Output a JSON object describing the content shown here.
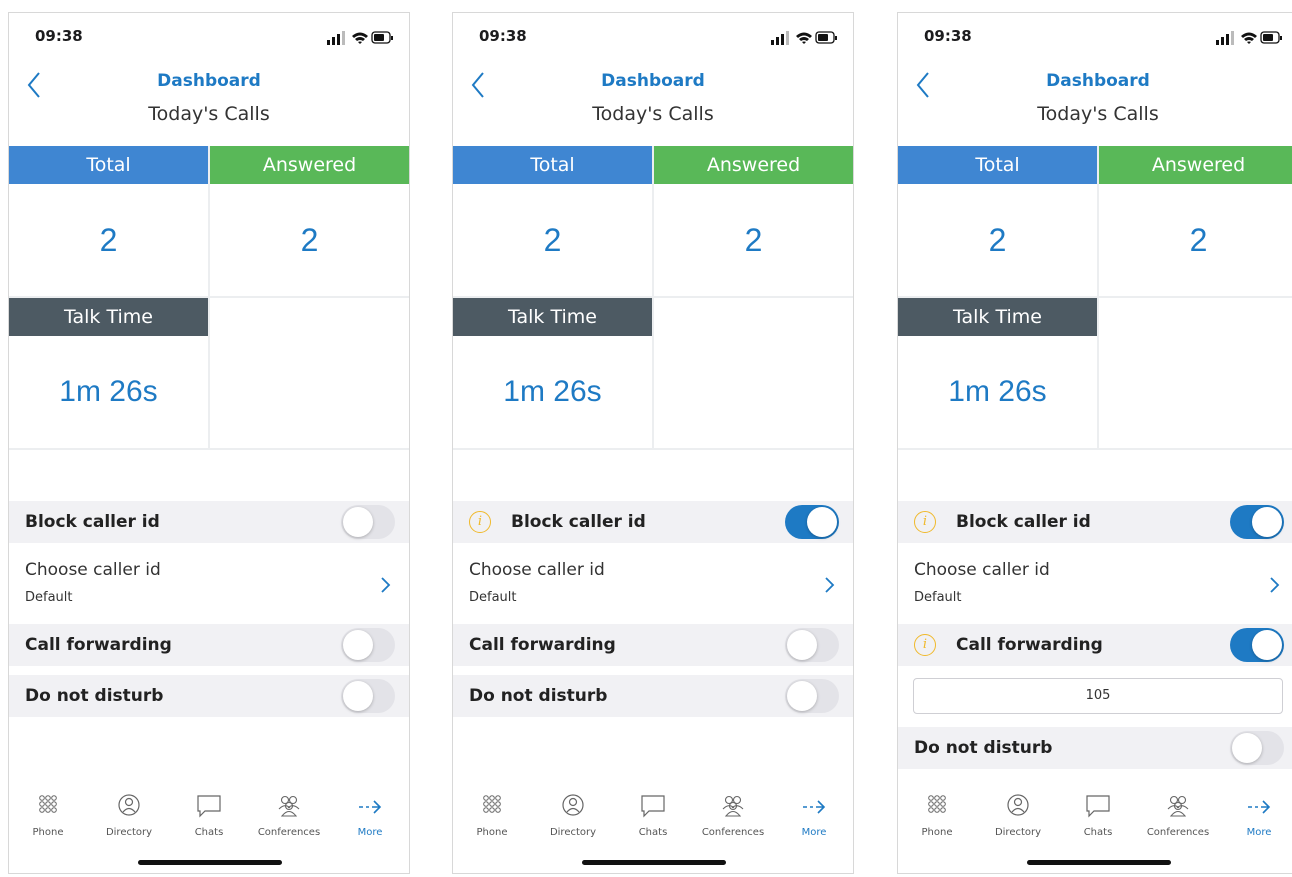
{
  "screens": [
    {
      "status_time": "09:38",
      "nav_title": "Dashboard",
      "nav_subtitle": "Today's Calls",
      "tiles": {
        "total_label": "Total",
        "total_value": "2",
        "answered_label": "Answered",
        "answered_value": "2",
        "talk_label": "Talk Time",
        "talk_value": "1m 26s"
      },
      "block_caller_id": {
        "label": "Block caller id",
        "on": false
      },
      "choose_caller_id": {
        "label": "Choose caller id",
        "value": "Default"
      },
      "call_forwarding": {
        "label": "Call forwarding",
        "on": false
      },
      "do_not_disturb": {
        "label": "Do not disturb",
        "on": false
      }
    },
    {
      "status_time": "09:38",
      "nav_title": "Dashboard",
      "nav_subtitle": "Today's Calls",
      "tiles": {
        "total_label": "Total",
        "total_value": "2",
        "answered_label": "Answered",
        "answered_value": "2",
        "talk_label": "Talk Time",
        "talk_value": "1m 26s"
      },
      "block_caller_id": {
        "label": "Block caller id",
        "on": true
      },
      "choose_caller_id": {
        "label": "Choose caller id",
        "value": "Default"
      },
      "call_forwarding": {
        "label": "Call forwarding",
        "on": false
      },
      "do_not_disturb": {
        "label": "Do not disturb",
        "on": false
      }
    },
    {
      "status_time": "09:38",
      "nav_title": "Dashboard",
      "nav_subtitle": "Today's Calls",
      "tiles": {
        "total_label": "Total",
        "total_value": "2",
        "answered_label": "Answered",
        "answered_value": "2",
        "talk_label": "Talk Time",
        "talk_value": "1m 26s"
      },
      "block_caller_id": {
        "label": "Block caller id",
        "on": true
      },
      "choose_caller_id": {
        "label": "Choose caller id",
        "value": "Default"
      },
      "call_forwarding": {
        "label": "Call forwarding",
        "on": true,
        "number": "105"
      },
      "do_not_disturb": {
        "label": "Do not disturb",
        "on": false
      }
    }
  ],
  "info_glyph": "i",
  "tabs": [
    {
      "label": "Phone",
      "icon": "keypad-icon"
    },
    {
      "label": "Directory",
      "icon": "person-icon"
    },
    {
      "label": "Chats",
      "icon": "chat-bubble-icon"
    },
    {
      "label": "Conferences",
      "icon": "group-icon"
    },
    {
      "label": "More",
      "icon": "arrow-right-icon",
      "active": true
    }
  ],
  "colors": {
    "accent": "#1e7ac4",
    "total": "#3f86d2",
    "answered": "#59b858",
    "talk_time": "#4d5a63",
    "info": "#f0b92b"
  }
}
